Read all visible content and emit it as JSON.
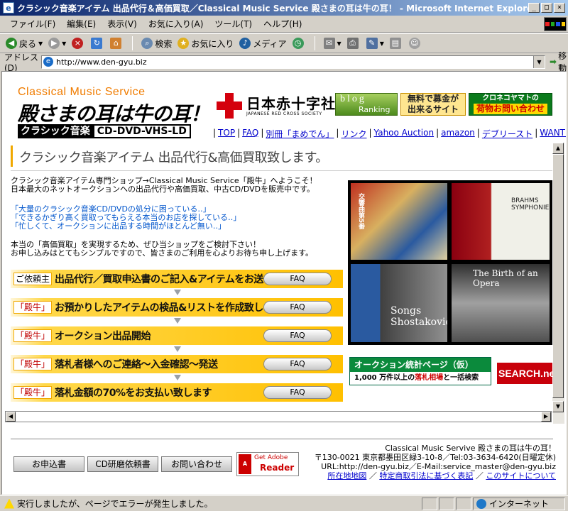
{
  "window": {
    "title": "クラシック音楽アイテム 出品代行＆高価買取／Classical Music Service 殿さまの耳は牛の耳！ - Microsoft Internet Explorer",
    "buttons": [
      "_",
      "□",
      "×"
    ]
  },
  "menu": [
    "ファイル(F)",
    "編集(E)",
    "表示(V)",
    "お気に入り(A)",
    "ツール(T)",
    "ヘルプ(H)"
  ],
  "toolbar": {
    "back": "戻る",
    "search": "検索",
    "favorites": "お気に入り",
    "media": "メディア"
  },
  "address": {
    "label": "アドレス(D)",
    "value": "http://www.den-gyu.biz",
    "go": "移動"
  },
  "header": {
    "logo_line1": "Classical Music Service",
    "logo_line2": "殿さまの耳は牛の耳！",
    "logo_dark": "クラシック音楽",
    "logo_outline": "CD-DVD-VHS-LD",
    "redcross_jp": "日本赤十字社",
    "redcross_en": "JAPANESE RED CROSS SOCIETY",
    "blog_line1": "blog",
    "blog_line2": "Ranking",
    "donate_line1": "無料で募金が",
    "donate_line2": "出来るサイト",
    "kuroneko_line1": "クロネコヤマトの",
    "kuroneko_line2": "荷物お問い合わせ"
  },
  "nav": [
    "TOP",
    "FAQ",
    "別冊「まめでん」",
    "リンク",
    "Yahoo Auction",
    "amazon",
    "デブリースト",
    "WANTED"
  ],
  "main": {
    "heading": "クラシック音楽アイテム 出品代行&高価買取致します。",
    "intro1": "クラシック音楽アイテム専門ショップ→Classical Music Service「殿牛」へようこそ！",
    "intro2": "日本最大のネットオークションへの出品代行や高価買取、中古CD/DVDを販売中です。",
    "quote1": "「大量のクラシック音楽CD/DVDの処分に困っている‥」",
    "quote2": "「できるかぎり高く買取ってもらえる本当のお店を探している‥」",
    "quote3": "「忙しくて、オークションに出品する時間がほとんど無い‥」",
    "intro3": "本当の「高価買取」を実現するため、ぜひ当ショップをご検討下さい！",
    "intro4": "お申し込みはとてもシンプルですので、皆さまのご利用を心よりお待ち申し上げます。"
  },
  "steps": [
    {
      "tag": "ご依頼主",
      "text": "出品代行／買取申込書のご記入&アイテムをお送り下さい",
      "faq": "FAQ"
    },
    {
      "tag": "「殿牛」",
      "text": "お預かりしたアイテムの検品&リストを作成致します",
      "faq": "FAQ"
    },
    {
      "tag": "「殿牛」",
      "text": "オークション出品開始",
      "faq": "FAQ"
    },
    {
      "tag": "「殿牛」",
      "text": "落札者様へのご連絡～入金確認～発送",
      "faq": "FAQ"
    },
    {
      "tag": "「殿牛」",
      "text": "落札金額の70%をお支払い致します",
      "faq": "FAQ"
    }
  ],
  "albums": {
    "a1": "交響曲第5番",
    "a2": "BRAHMS SYMPHONIES",
    "a3": "Songs Shostakovich",
    "a4": "The Birth of an Opera"
  },
  "side": {
    "stats_line1": "オークション統計ページ（仮）",
    "stats_prefix": "1,000 万件以上の",
    "stats_red": "落札相場",
    "stats_suffix": "と一括検索",
    "search_banner": "SEARCH.ne"
  },
  "footer": {
    "btn_apply": "お申込書",
    "btn_cd": "CD研磨依頼書",
    "btn_contact": "お問い合わせ",
    "adobe_get": "Get Adobe",
    "adobe_reader": "Reader",
    "line1": "Classical Music Servive 殿さまの耳は牛の耳！",
    "line2": "〒130-0021 東京都墨田区緑3-10-8／Tel:03-3634-6420(日曜定休)",
    "line3": "URL:http://den-gyu.biz／E-Mail:service_master@den-gyu.biz",
    "link_map": "所在地地図",
    "link_law": "特定商取引法に基づく表記",
    "link_about": "このサイトについて"
  },
  "status": {
    "text": "実行しましたが、ページでエラーが発生しました。",
    "zone": "インターネット"
  },
  "colors": {
    "accent_orange": "#f07c00",
    "step_yellow": "#ffc000",
    "link_blue": "#0000cc",
    "red_cross": "#d4000d"
  }
}
